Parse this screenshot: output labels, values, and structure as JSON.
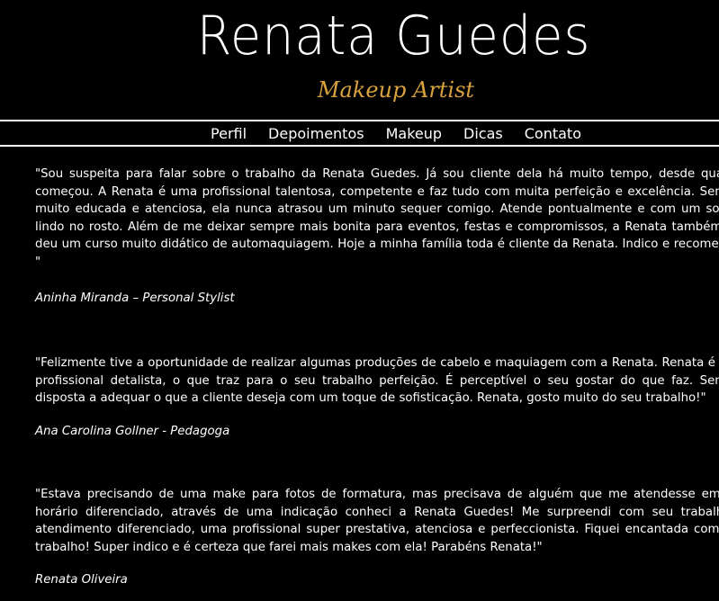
{
  "header": {
    "brand_name": "Renata Guedes",
    "tagline": "Makeup Artist"
  },
  "nav": {
    "items": [
      "Perfil",
      "Depoimentos",
      "Makeup",
      "Dicas",
      "Contato"
    ]
  },
  "testimonials": [
    {
      "quote": "\"Sou suspeita para falar sobre o trabalho da Renata Guedes. Já sou cliente dela há muito tempo, desde quando começou. A Renata é uma profissional talentosa, competente e faz tudo com muita perfeição e excelência. Sempre muito educada e atenciosa, ela nunca atrasou um minuto sequer comigo. Atende pontualmente e com um sorriso lindo no rosto. Além de me deixar sempre mais bonita para eventos, festas e compromissos, a Renata também me deu um curso muito didático de automaquiagem. Hoje a minha família toda é cliente da Renata. Indico e recomendo! \"",
      "author": "Aninha Miranda – Personal Stylist"
    },
    {
      "quote": "\"Felizmente tive a oportunidade de realizar algumas produções de cabelo e maquiagem com a Renata. Renata é uma profissional detalista, o que traz para o seu trabalho perfeição. É perceptível o seu gostar do que faz. Sempre disposta a adequar o que a cliente deseja com um toque de sofisticação. Renata, gosto muito do seu trabalho!\"",
      "author": "Ana Carolina Gollner - Pedagoga"
    },
    {
      "quote": "\"Estava precisando de uma make para fotos de formatura, mas precisava de alguém que me atendesse em um horário diferenciado, através de uma indicação conheci a Renata Guedes! Me surpreendi com seu trabalho e atendimento diferenciado, uma profissional super prestativa, atenciosa e perfeccionista. Fiquei encantada com seu trabalho! Super indico e é certeza que farei mais makes com ela! Parabéns Renata!\"",
      "author": "Renata Oliveira"
    }
  ],
  "colors": {
    "background": "#000000",
    "text": "#ffffff",
    "accent": "#d9a23e"
  }
}
